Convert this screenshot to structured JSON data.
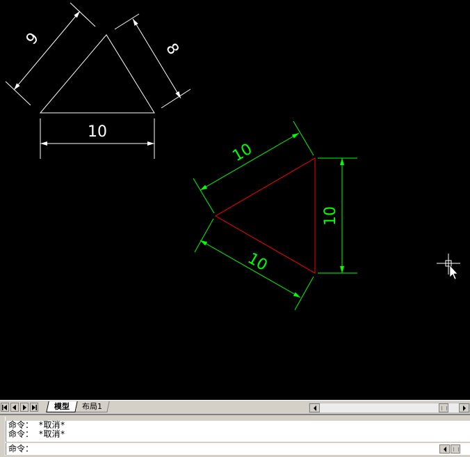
{
  "drawing": {
    "left_triangle": {
      "base_label": "10",
      "left_label": "9",
      "right_label": "8",
      "edge_color": "#ffffff",
      "dim_color": "#ffffff"
    },
    "right_triangle": {
      "top_left_label": "10",
      "bottom_left_label": "10",
      "right_label": "10",
      "edge_color": "#ff0000",
      "dim_color": "#00ff00"
    },
    "cursor": "crosshair-cursor"
  },
  "tab_bar": {
    "nav_buttons": [
      "first-tab",
      "previous-tab",
      "next-tab",
      "last-tab"
    ],
    "tabs": [
      {
        "label": "模型",
        "active": true
      },
      {
        "label": "布局1",
        "active": false
      }
    ]
  },
  "command_window": {
    "history": [
      "命令： *取消*",
      "命令： *取消*"
    ],
    "prompt": "命令："
  }
}
